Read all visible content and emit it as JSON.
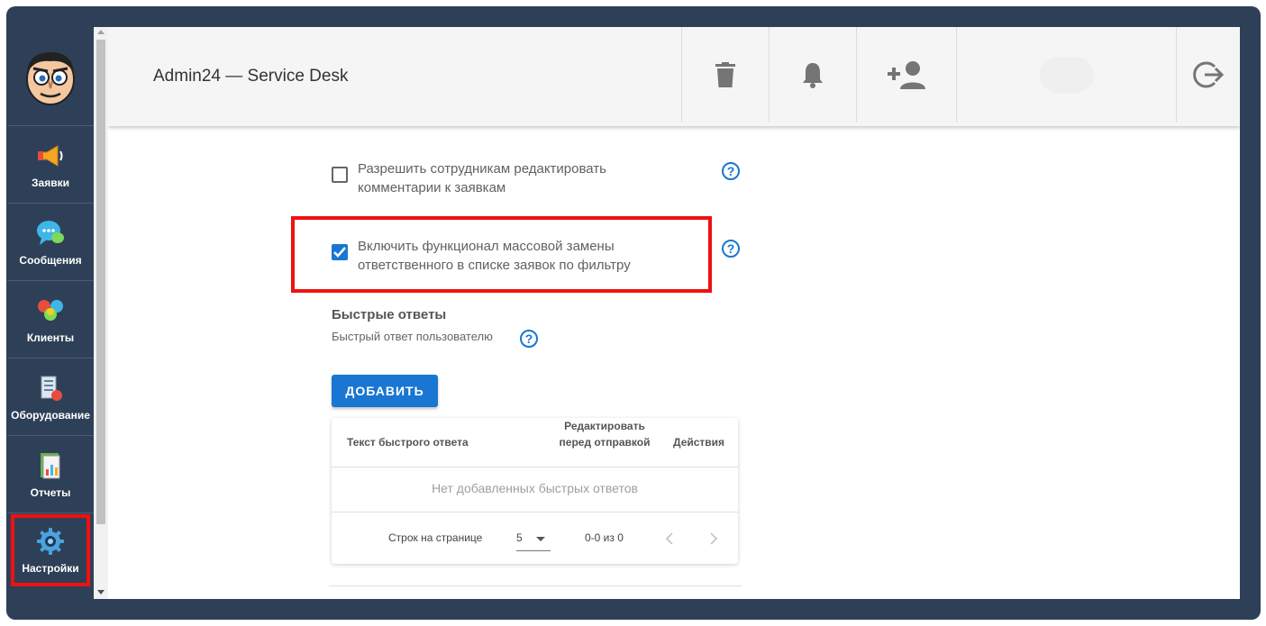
{
  "app": {
    "title": "Admin24 — Service Desk"
  },
  "sidebar": {
    "items": [
      {
        "label": "Заявки",
        "icon": "megaphone-icon"
      },
      {
        "label": "Сообщения",
        "icon": "chat-bubbles-icon"
      },
      {
        "label": "Клиенты",
        "icon": "clients-icon"
      },
      {
        "label": "Оборудование",
        "icon": "equipment-icon"
      },
      {
        "label": "Отчеты",
        "icon": "reports-icon"
      },
      {
        "label": "Настройки",
        "icon": "gear-icon"
      }
    ],
    "active": "Настройки"
  },
  "toolbar": {
    "buttons": [
      "trash-icon",
      "bell-icon",
      "add-user-icon",
      "logout-icon"
    ]
  },
  "settings": {
    "allow_edit_comments": {
      "label": "Разрешить сотрудникам редактировать комментарии к заявкам",
      "checked": false
    },
    "mass_replace": {
      "label": "Включить функционал массовой замены ответственного в списке заявок по фильтру",
      "checked": true
    }
  },
  "quick_replies": {
    "title": "Быстрые ответы",
    "subtitle": "Быстрый ответ пользователю",
    "add_button": "ДОБАВИТЬ",
    "columns": [
      "Текст быстрого ответа",
      "Редактировать перед отправкой",
      "Действия"
    ],
    "empty_text": "Нет добавленных быстрых ответов",
    "rows_per_page_label": "Строк на странице",
    "rows_per_page_value": "5",
    "range_text": "0-0 из 0"
  },
  "colors": {
    "sidebar_bg": "#2e4057",
    "accent": "#1976d2",
    "highlight": "#ee1111"
  }
}
